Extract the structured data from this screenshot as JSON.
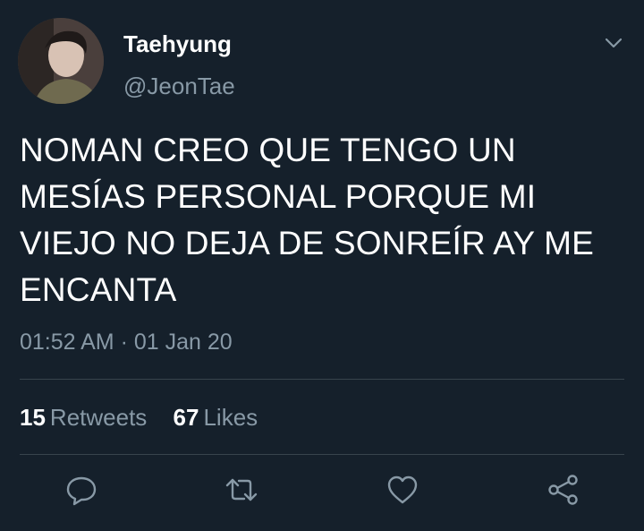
{
  "user": {
    "display_name": "Taehyung",
    "handle": "@JeonTae"
  },
  "tweet": {
    "text": "NOMAN CREO QUE TENGO UN MESÍAS PERSONAL PORQUE MI VIEJO NO DEJA DE SONREÍR AY ME ENCANTA",
    "timestamp": "01:52 AM · 01 Jan 20"
  },
  "stats": {
    "retweets_count": "15",
    "retweets_label": "Retweets",
    "likes_count": "67",
    "likes_label": "Likes"
  },
  "icons": {
    "menu": "chevron-down-icon",
    "reply": "reply-icon",
    "retweet": "retweet-icon",
    "like": "heart-icon",
    "share": "share-icon"
  },
  "colors": {
    "background": "#15202b",
    "primary_text": "#ffffff",
    "secondary_text": "#8899a6",
    "divider": "#38444d"
  }
}
